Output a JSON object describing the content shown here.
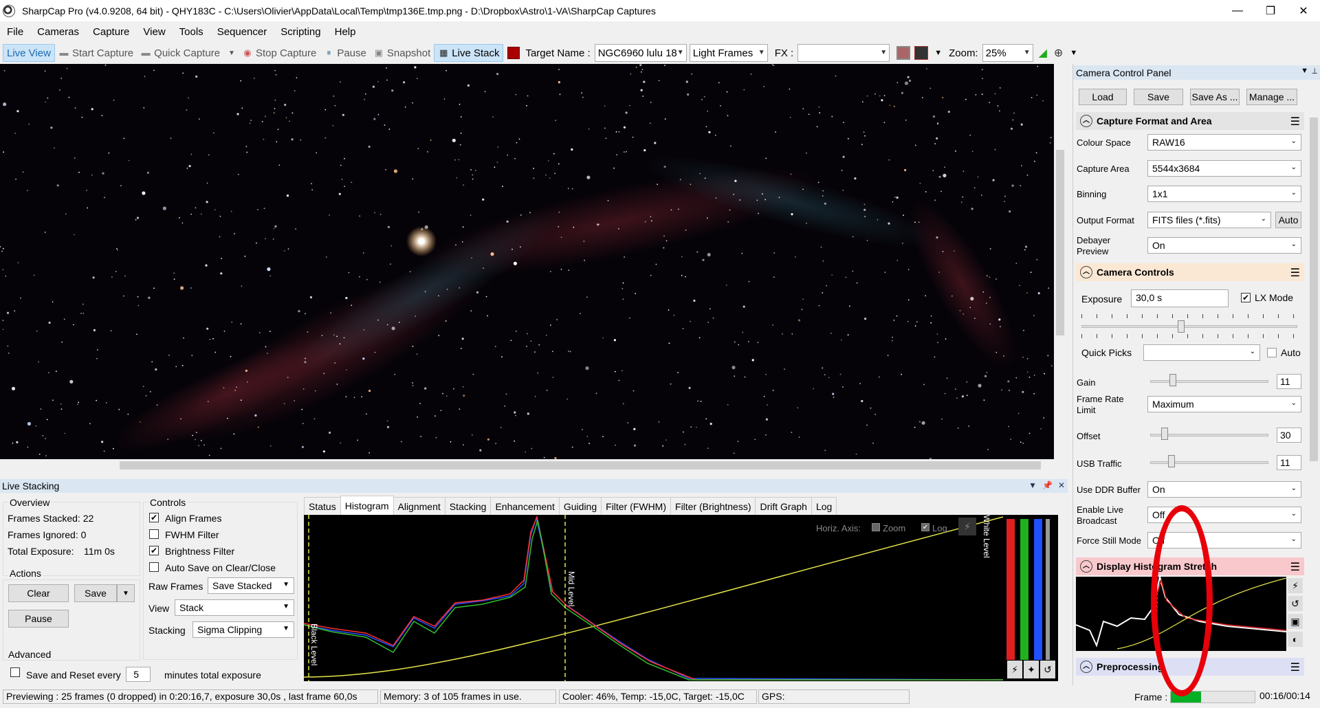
{
  "window": {
    "title": "SharpCap Pro (v4.0.9208, 64 bit) - QHY183C - C:\\Users\\Olivier\\AppData\\Local\\Temp\\tmp136E.tmp.png - D:\\Dropbox\\Astro\\1-VA\\SharpCap Captures",
    "minimize": "—",
    "maximize": "❐",
    "close": "✕"
  },
  "menu": [
    "File",
    "Cameras",
    "Capture",
    "View",
    "Tools",
    "Sequencer",
    "Scripting",
    "Help"
  ],
  "toolbar": {
    "live_view": "Live View",
    "start_capture": "Start Capture",
    "quick_capture": "Quick Capture",
    "stop_capture": "Stop Capture",
    "pause": "Pause",
    "snapshot": "Snapshot",
    "live_stack": "Live Stack",
    "target_name_label": "Target Name :",
    "target_name_value": "NGC6960 lulu 18",
    "frame_type": "Light Frames",
    "fx_label": "FX :",
    "fx_value": "",
    "zoom_label": "Zoom:",
    "zoom_value": "25%"
  },
  "live_stacking": {
    "title": "Live Stacking",
    "overview": {
      "title": "Overview",
      "frames_stacked": "Frames Stacked: 22",
      "frames_ignored": "Frames Ignored: 0",
      "total_exposure_label": "Total Exposure:",
      "total_exposure_value": "11m 0s"
    },
    "actions": {
      "title": "Actions",
      "clear": "Clear",
      "save": "Save",
      "pause": "Pause"
    },
    "advanced": {
      "title": "Advanced",
      "save_reset_label": "Save and Reset every",
      "save_reset_value": "5",
      "save_reset_suffix": "minutes total exposure"
    },
    "controls": {
      "title": "Controls",
      "align_frames": "Align Frames",
      "fwhm_filter": "FWHM Filter",
      "brightness_filter": "Brightness Filter",
      "auto_save": "Auto Save on Clear/Close",
      "raw_frames_label": "Raw Frames",
      "raw_frames_value": "Save Stacked",
      "view_label": "View",
      "view_value": "Stack",
      "stacking_label": "Stacking",
      "stacking_value": "Sigma Clipping"
    },
    "tabs": [
      "Status",
      "Histogram",
      "Alignment",
      "Stacking",
      "Enhancement",
      "Guiding",
      "Filter (FWHM)",
      "Filter (Brightness)",
      "Drift Graph",
      "Log"
    ],
    "histogram": {
      "horiz_axis": "Horiz. Axis:",
      "zoom": "Zoom",
      "log": "Log",
      "black_level": "Black Level",
      "mid_level": "Mid Level",
      "white_level": "White Level"
    }
  },
  "camera_panel": {
    "title": "Camera Control Panel",
    "buttons": [
      "Load",
      "Save",
      "Save As ...",
      "Manage ..."
    ],
    "capture_format": {
      "title": "Capture Format and Area",
      "colour_space_label": "Colour Space",
      "colour_space_value": "RAW16",
      "capture_area_label": "Capture Area",
      "capture_area_value": "5544x3684",
      "binning_label": "Binning",
      "binning_value": "1x1",
      "output_format_label": "Output Format",
      "output_format_value": "FITS files (*.fits)",
      "auto": "Auto",
      "debayer_label_1": "Debayer",
      "debayer_label_2": "Preview",
      "debayer_value": "On"
    },
    "camera_controls": {
      "title": "Camera Controls",
      "exposure_label": "Exposure",
      "exposure_value": "30,0 s",
      "lx_mode": "LX Mode",
      "quick_picks_label": "Quick Picks",
      "auto": "Auto",
      "gain_label": "Gain",
      "gain_value": "11",
      "frame_rate_label_1": "Frame Rate",
      "frame_rate_label_2": "Limit",
      "frame_rate_value": "Maximum",
      "offset_label": "Offset",
      "offset_value": "30",
      "usb_label": "USB Traffic",
      "usb_value": "11",
      "ddr_label": "Use DDR Buffer",
      "ddr_value": "On",
      "broadcast_label_1": "Enable Live",
      "broadcast_label_2": "Broadcast",
      "broadcast_value": "Off",
      "force_still_label": "Force Still Mode",
      "force_still_value": "Off"
    },
    "display_histogram": {
      "title": "Display Histogram Stretch"
    },
    "preprocessing": {
      "title": "Preprocessing"
    }
  },
  "statusbar": {
    "previewing": "Previewing : 25 frames (0 dropped) in 0:20:16,7, exposure 30,0s , last frame 60,0s",
    "memory": "Memory: 3 of 105 frames in use.",
    "cooler": "Cooler: 46%, Temp: -15,0C, Target: -15,0C",
    "gps": "GPS:",
    "frame_label": "Frame :",
    "frame_progress": 0.36,
    "time": "00:16/00:14"
  },
  "colors": {
    "accent_panel": "#dae6f2",
    "highlight_red": "#e8000b",
    "progress_green": "#06b025"
  }
}
